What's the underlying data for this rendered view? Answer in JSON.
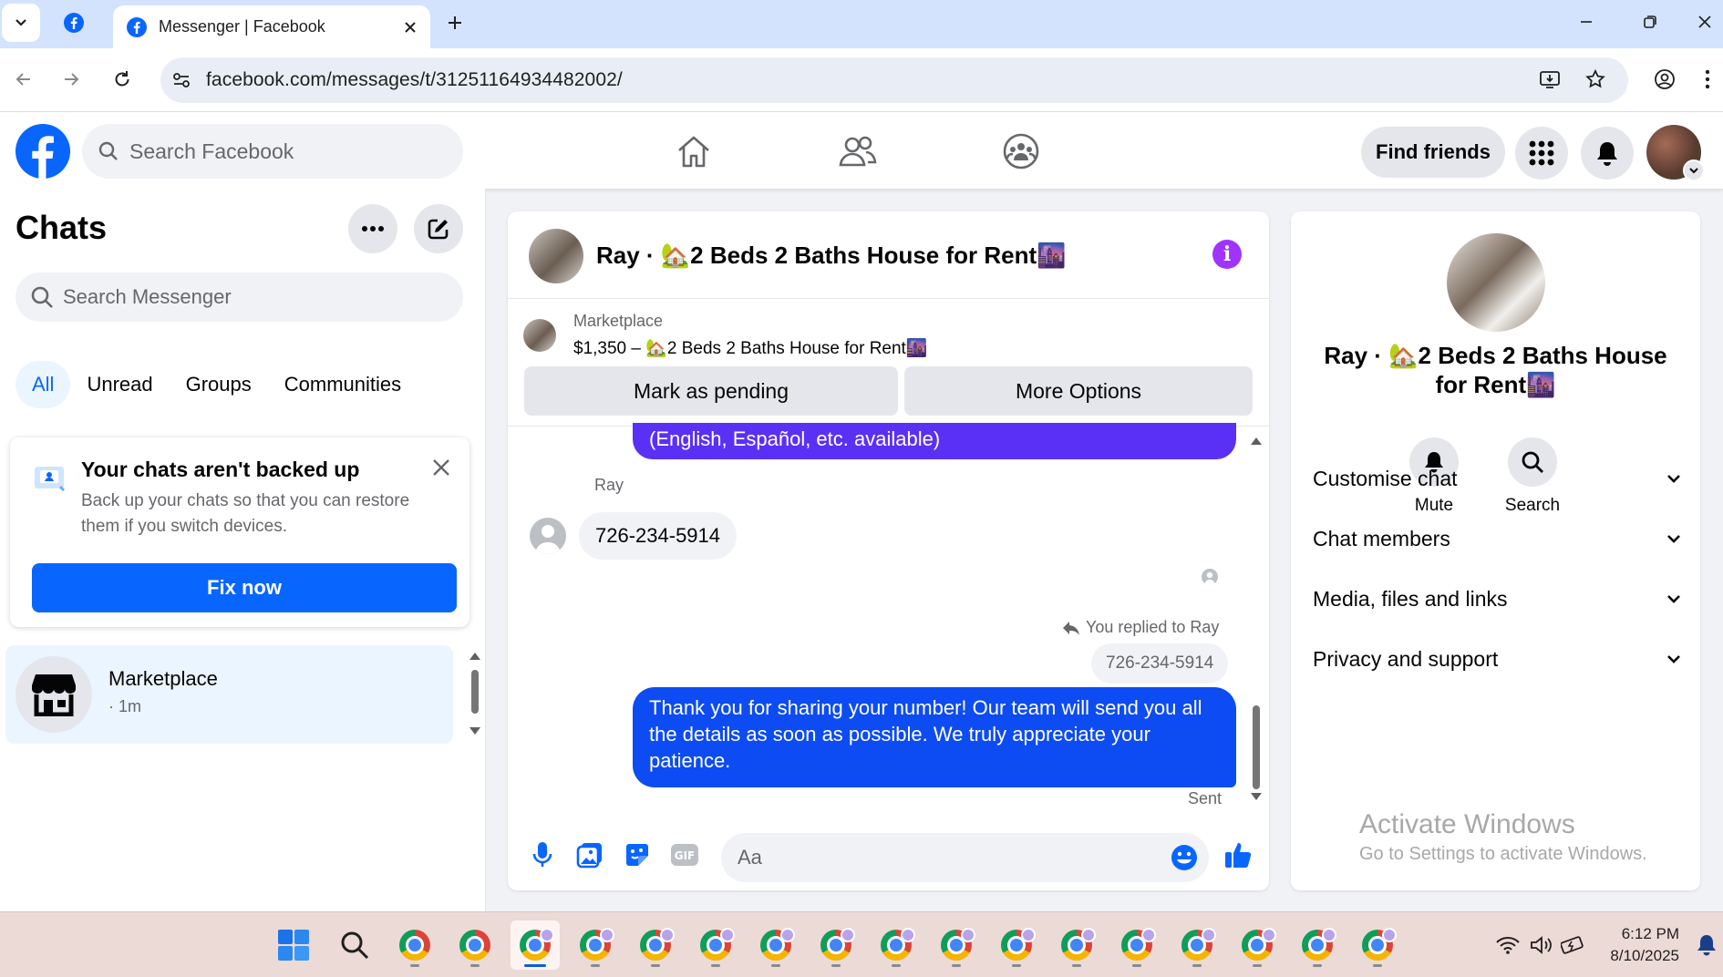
{
  "browser": {
    "tab_title": "Messenger | Facebook",
    "url": "facebook.com/messages/t/31251164934482002/"
  },
  "fb_header": {
    "search_placeholder": "Search Facebook",
    "find_friends": "Find friends"
  },
  "sidebar": {
    "title": "Chats",
    "search_placeholder": "Search Messenger",
    "filters": [
      "All",
      "Unread",
      "Groups",
      "Communities"
    ],
    "backup_notice": {
      "title": "Your chats aren't backed up",
      "text": "Back up your chats so that you can restore them if you switch devices.",
      "button": "Fix now"
    },
    "chat_row": {
      "name": "Marketplace",
      "time": "· 1m"
    }
  },
  "conversation": {
    "title": "Ray · 🏡2 Beds 2 Baths House for Rent🌆",
    "marketplace_label": "Marketplace",
    "listing": "$1,350 – 🏡2 Beds 2 Baths House for Rent🌆",
    "btn_pending": "Mark as pending",
    "btn_more": "More Options",
    "msg_partial": "(English, Español, etc. available)",
    "sender": "Ray",
    "msg_in": "726-234-5914",
    "replied_to": "You replied to Ray",
    "quoted": "726-234-5914",
    "msg_out": "Thank you for sharing your number!  Our team will send you all the details as soon as possible. We truly appreciate your patience.",
    "status": "Sent",
    "composer_placeholder": "Aa"
  },
  "details": {
    "name": "Ray · 🏡2 Beds 2 Baths House for Rent🌆",
    "mute": "Mute",
    "search": "Search",
    "sections": [
      "Customise chat",
      "Chat members",
      "Media, files and links",
      "Privacy and support"
    ]
  },
  "watermark": {
    "line1": "Activate Windows",
    "line2": "Go to Settings to activate Windows."
  },
  "taskbar": {
    "time": "6:12 PM",
    "date": "8/10/2025"
  },
  "colors": {
    "fb_blue": "#0866ff",
    "outgoing_bubble": "#0d4cf2",
    "purple_bubble": "#5b30f5",
    "info_purple": "#a033ff"
  }
}
